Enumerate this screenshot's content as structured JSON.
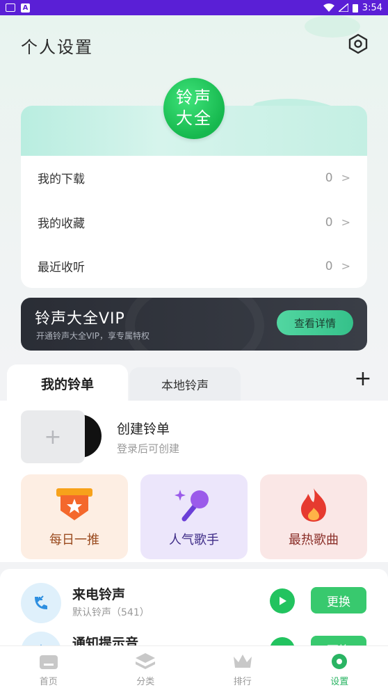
{
  "status_bar": {
    "time": "3:54",
    "left_icons": [
      "mail-icon",
      "a-icon"
    ],
    "right_icons": [
      "wifi-icon",
      "signal-icon",
      "battery-icon"
    ]
  },
  "header": {
    "title": "个人设置",
    "settings_icon": "hexagon-settings-icon"
  },
  "logo": {
    "line1": "铃声",
    "line2": "大全"
  },
  "profile_menu": [
    {
      "label": "我的下载",
      "count": "0"
    },
    {
      "label": "我的收藏",
      "count": "0"
    },
    {
      "label": "最近收听",
      "count": "0"
    }
  ],
  "chevron": ">",
  "vip": {
    "title": "铃声大全VIP",
    "subtitle": "开通铃声大全VIP，享专属特权",
    "button": "查看详情"
  },
  "tabs": {
    "active": "我的铃单",
    "inactive": "本地铃声",
    "add": "+"
  },
  "create_playlist": {
    "plus": "+",
    "title": "创建铃单",
    "subtitle": "登录后可创建"
  },
  "categories": [
    {
      "label": "每日一推",
      "icon": "star-badge-icon",
      "bg": "#fdeee3",
      "color": "#9a4b1f"
    },
    {
      "label": "人气歌手",
      "icon": "microphone-icon",
      "bg": "#ece6fb",
      "color": "#3d2a86"
    },
    {
      "label": "最热歌曲",
      "icon": "fire-icon",
      "bg": "#fae7e6",
      "color": "#8a2e28"
    }
  ],
  "ringtones": [
    {
      "title": "来电铃声",
      "subtitle": "默认铃声（541）",
      "button": "更换",
      "icon": "incoming-call-icon"
    },
    {
      "title": "通知提示音",
      "subtitle": "",
      "button": "更换",
      "icon": "notification-icon"
    }
  ],
  "bottom_nav": [
    {
      "label": "首页",
      "icon": "home-icon",
      "active": false
    },
    {
      "label": "分类",
      "icon": "layers-icon",
      "active": false
    },
    {
      "label": "排行",
      "icon": "crown-icon",
      "active": false
    },
    {
      "label": "设置",
      "icon": "gear-icon",
      "active": true
    }
  ],
  "colors": {
    "accent": "#2ab463",
    "status_bar": "#5a1fd6",
    "vip_bg": "#2a2d35",
    "vip_button": "#35c18a"
  }
}
